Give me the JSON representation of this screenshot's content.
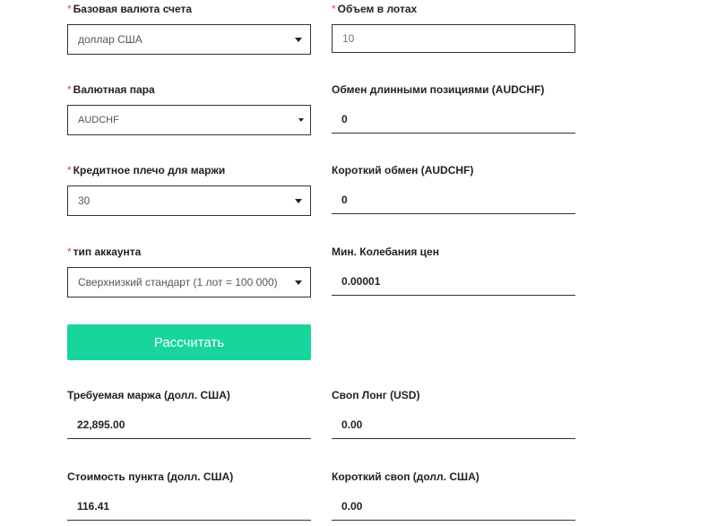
{
  "form": {
    "base_currency": {
      "label": "Базовая валюта счета",
      "required_mark": "*",
      "value": "доллар США"
    },
    "lot_volume": {
      "label": "Объем в лотах",
      "required_mark": "*",
      "placeholder": "10"
    },
    "currency_pair": {
      "label": "Валютная пара",
      "required_mark": "*",
      "value": "AUDCHF"
    },
    "long_swap_exchange": {
      "label": "Обмен длинными позициями (AUDCHF)",
      "value": "0"
    },
    "leverage": {
      "label": "Кредитное плечо для маржи",
      "required_mark": "*",
      "value": "30"
    },
    "short_swap_exchange": {
      "label": "Короткий обмен (AUDCHF)",
      "value": "0"
    },
    "account_type": {
      "label": "тип аккаунта",
      "required_mark": "*",
      "value": "Сверхнизкий стандарт (1 лот = 100 000)"
    },
    "min_price_fluctuation": {
      "label": "Мин. Колебания цен",
      "value": "0.00001"
    },
    "calculate_button": {
      "label": "Рассчитать"
    }
  },
  "results": {
    "required_margin": {
      "label": "Требуемая маржа (долл. США)",
      "value": "22,895.00"
    },
    "swap_long": {
      "label": "Своп Лонг (USD)",
      "value": "0.00"
    },
    "pip_value": {
      "label": "Стоимость пункта (долл. США)",
      "value": "116.41"
    },
    "swap_short": {
      "label": "Короткий своп (долл. США)",
      "value": "0.00"
    }
  },
  "colors": {
    "accent": "#17d59b",
    "required_mark": "#e0443a",
    "border": "#333333"
  }
}
